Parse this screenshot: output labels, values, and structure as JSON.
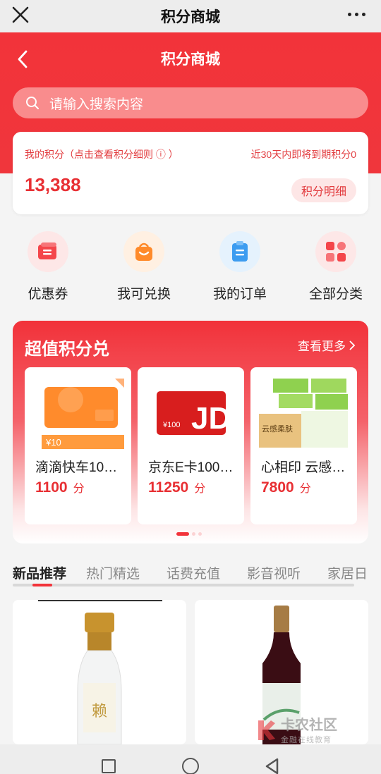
{
  "window": {
    "title": "积分商城"
  },
  "header": {
    "title": "积分商城"
  },
  "search": {
    "placeholder": "请输入搜索内容"
  },
  "points": {
    "label": "我的积分（点击查看积分细则 ⓘ ）",
    "expiring": "近30天内即将到期积分0",
    "value": "13,388",
    "detail_button": "积分明细"
  },
  "quick": [
    {
      "label": "优惠券",
      "icon": "coupon-icon",
      "color": "#f2333a",
      "bg": "#fde7e7"
    },
    {
      "label": "我可兑换",
      "icon": "shopping-bag-icon",
      "color": "#ff8a2a",
      "bg": "#fff0e2"
    },
    {
      "label": "我的订单",
      "icon": "clipboard-icon",
      "color": "#3c9cf0",
      "bg": "#e5f2fd"
    },
    {
      "label": "全部分类",
      "icon": "grid-icon",
      "color": "#f2333a",
      "bg": "#fde7e7"
    }
  ],
  "promo": {
    "title": "超值积分兑",
    "more": "查看更多",
    "items": [
      {
        "name": "滴滴快车10…",
        "price": "1100",
        "unit": "分",
        "thumb_text": "¥10"
      },
      {
        "name": "京东E卡100…",
        "price": "11250",
        "unit": "分",
        "thumb_text": "JD",
        "thumb_small": "¥100"
      },
      {
        "name": "心相印 云感…",
        "price": "7800",
        "unit": "分",
        "thumb_text": "云感柔肤"
      }
    ]
  },
  "tabs": [
    "新品推荐",
    "热门精选",
    "话费充值",
    "影音视听",
    "家居日"
  ],
  "products": [
    {
      "thumb_text": "赖"
    },
    {
      "thumb_text": ""
    }
  ],
  "watermark": {
    "title": "卡农社区",
    "subtitle": "金融在线教育"
  },
  "colors": {
    "brand_red": "#f2333a",
    "price_red": "#e83034"
  }
}
